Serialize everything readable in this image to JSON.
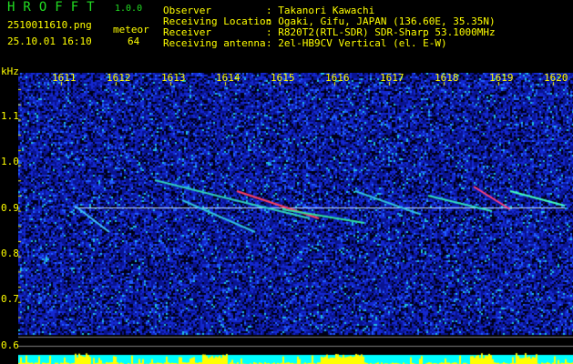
{
  "header": {
    "app_title": "HROFFT",
    "app_version": "1.0.0",
    "filename": "2510011610.png",
    "datetime": "25.10.01 16:10",
    "meteor_label": "meteor",
    "meteor_count": "64"
  },
  "info": [
    {
      "label": "Observer",
      "value": ": Takanori Kawachi"
    },
    {
      "label": "Receiving Location",
      "value": ": Ogaki, Gifu, JAPAN (136.60E, 35.35N)"
    },
    {
      "label": "Receiver",
      "value": ": R820T2(RTL-SDR) SDR-Sharp 53.1000MHz"
    },
    {
      "label": "Receiving antenna",
      "value": ": 2el-HB9CV Vertical (el. E-W)"
    }
  ],
  "spectrogram": {
    "y_unit": "kHz",
    "x_ticks": [
      "1611",
      "1612",
      "1613",
      "1614",
      "1615",
      "1616",
      "1617",
      "1618",
      "1619",
      "1620"
    ],
    "y_ticks": [
      "1.1",
      "1.0",
      "0.9",
      "0.8",
      "0.7",
      "0.6"
    ],
    "colors": {
      "text": "#ffff00",
      "title": "#22dd22",
      "noise": "#1020a0",
      "level_bar": "#ffff00",
      "baseline": "#00ffff"
    }
  }
}
